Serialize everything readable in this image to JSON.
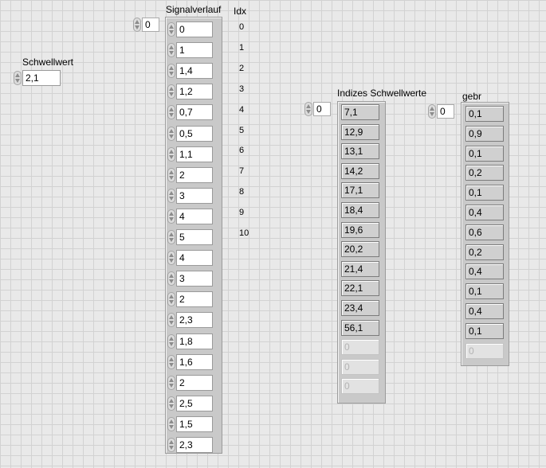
{
  "schwellwert": {
    "label": "Schwellwert",
    "value": "2,1"
  },
  "signalverlauf": {
    "label": "Signalverlauf",
    "index": "0",
    "values": [
      "0",
      "1",
      "1,4",
      "1,2",
      "0,7",
      "0,5",
      "1,1",
      "2",
      "3",
      "4",
      "5",
      "4",
      "3",
      "2",
      "2,3",
      "1,8",
      "1,6",
      "2",
      "2,5",
      "1,5",
      "2,3"
    ]
  },
  "idx": {
    "label": "Idx",
    "values": [
      "0",
      "1",
      "2",
      "3",
      "4",
      "5",
      "6",
      "7",
      "8",
      "9",
      "10"
    ]
  },
  "indizes": {
    "label": "Indizes Schwellwerte",
    "index": "0",
    "values": [
      "7,1",
      "12,9",
      "13,1",
      "14,2",
      "17,1",
      "18,4",
      "19,6",
      "20,2",
      "21,4",
      "22,1",
      "23,4",
      "56,1"
    ],
    "empty_values": [
      "0",
      "0",
      "0"
    ]
  },
  "gebr": {
    "label": "gebr",
    "index": "0",
    "values": [
      "0,1",
      "0,9",
      "0,1",
      "0,2",
      "0,1",
      "0,4",
      "0,6",
      "0,2",
      "0,4",
      "0,1",
      "0,4",
      "0,1"
    ],
    "empty_values": [
      "0"
    ]
  }
}
